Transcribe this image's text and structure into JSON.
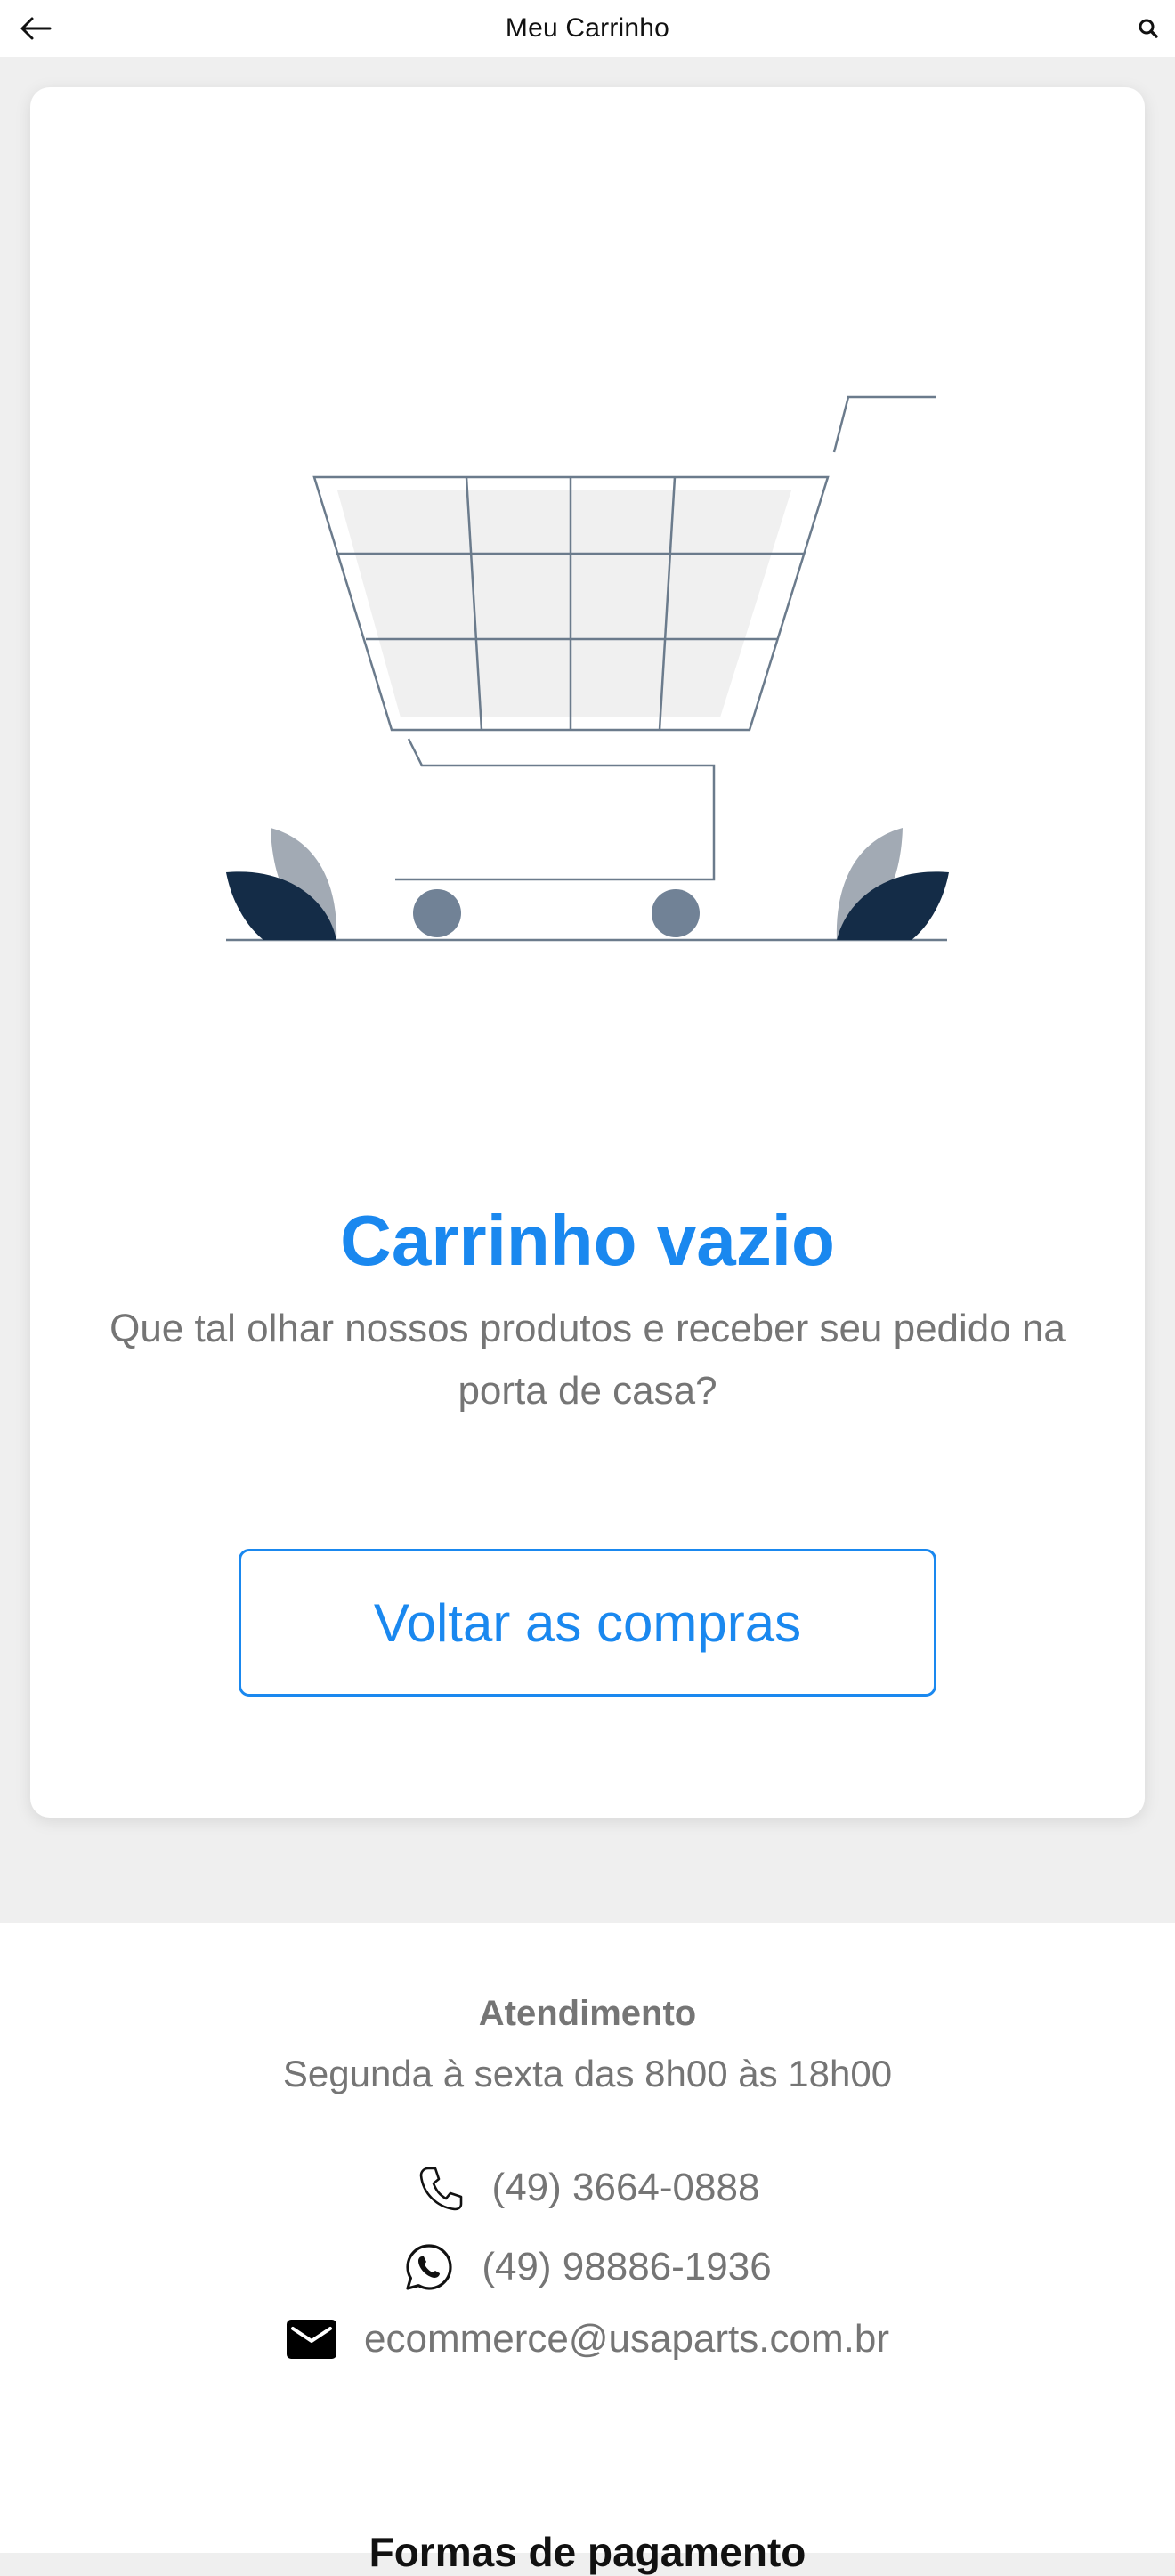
{
  "header": {
    "title": "Meu Carrinho",
    "back_icon": "arrow-left-icon",
    "search_icon": "search-icon"
  },
  "empty_cart": {
    "illustration": "empty-shopping-cart-illustration",
    "title": "Carrinho vazio",
    "message": "Que tal olhar nossos produtos e receber seu pedido na porta de casa?",
    "button_label": "Voltar as compras"
  },
  "footer": {
    "heading": "Atendimento",
    "hours": "Segunda à sexta das 8h00 às 18h00",
    "contacts": [
      {
        "icon": "phone-icon",
        "text": "(49) 3664-0888"
      },
      {
        "icon": "whatsapp-icon",
        "text": "(49) 98886-1936"
      },
      {
        "icon": "mail-icon",
        "text": "ecommerce@usaparts.com.br"
      }
    ],
    "payment_heading": "Formas de pagamento"
  },
  "colors": {
    "accent": "#1a88ef",
    "text_muted": "#757575",
    "background": "#efefef",
    "cart_stroke": "#6b7b8c",
    "leaf_dark": "#142c47",
    "leaf_light": "#a2aab4"
  }
}
